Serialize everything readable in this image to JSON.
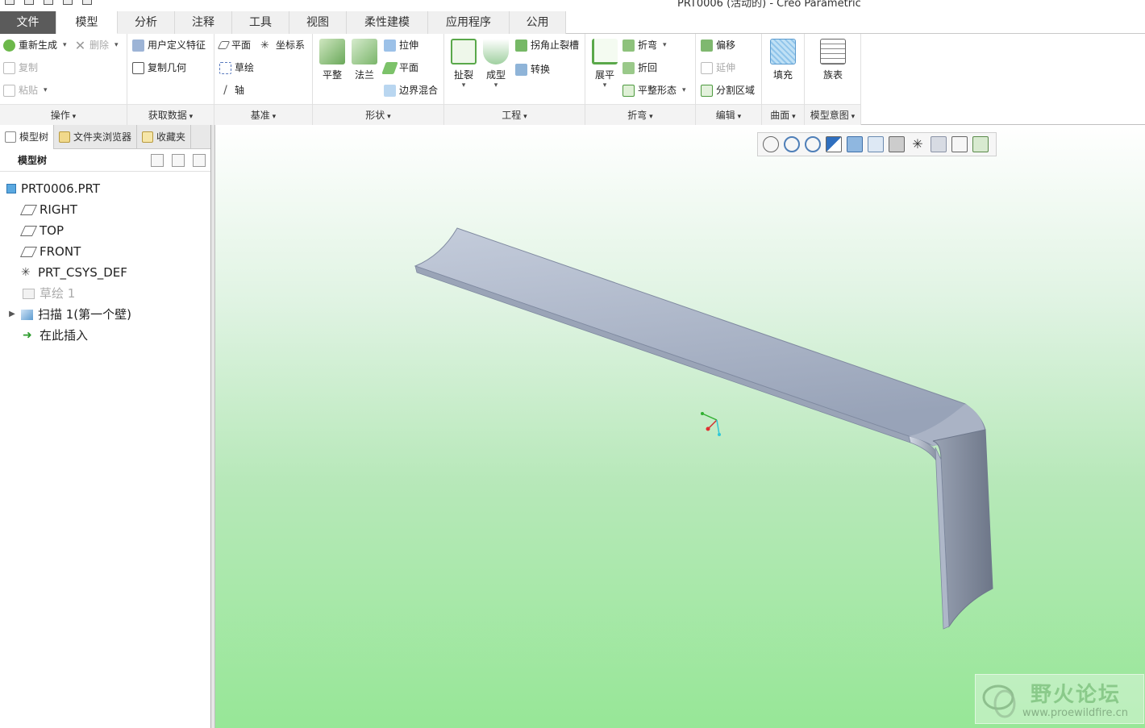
{
  "window": {
    "title": "PRT0006 (活动的) - Creo Parametric"
  },
  "tabs": [
    {
      "label": "文件"
    },
    {
      "label": "模型"
    },
    {
      "label": "分析"
    },
    {
      "label": "注释"
    },
    {
      "label": "工具"
    },
    {
      "label": "视图"
    },
    {
      "label": "柔性建模"
    },
    {
      "label": "应用程序"
    },
    {
      "label": "公用"
    }
  ],
  "ribbon": {
    "operations": {
      "footer": "操作",
      "regenerate": "重新生成",
      "delete": "删除",
      "copy": "复制",
      "paste": "粘贴"
    },
    "get_data": {
      "footer": "获取数据",
      "udf": "用户定义特征",
      "copy_geom": "复制几何"
    },
    "datum": {
      "footer": "基准",
      "plane": "平面",
      "csys": "坐标系",
      "sketch": "草绘",
      "axis": "轴"
    },
    "shape": {
      "footer": "形状",
      "flat": "平整",
      "flange": "法兰",
      "extrude": "拉伸",
      "planar": "平面",
      "blend": "边界混合"
    },
    "engineering": {
      "footer": "工程",
      "rip": "扯裂",
      "form": "成型",
      "corner_relief": "拐角止裂槽",
      "convert": "转换"
    },
    "bend": {
      "footer": "折弯",
      "unbend": "展平",
      "bend": "折弯",
      "bend_back": "折回",
      "flat_state": "平整形态"
    },
    "editing": {
      "footer": "编辑",
      "offset": "偏移",
      "extend": "延伸",
      "split_area": "分割区域"
    },
    "surface": {
      "footer": "曲面",
      "fill": "填充"
    },
    "intent": {
      "footer": "模型意图",
      "family": "族表"
    }
  },
  "panel": {
    "tabs": [
      {
        "label": "模型树"
      },
      {
        "label": "文件夹浏览器"
      },
      {
        "label": "收藏夹"
      }
    ],
    "header": "模型树",
    "tree": [
      {
        "label": "PRT0006.PRT"
      },
      {
        "label": "RIGHT"
      },
      {
        "label": "TOP"
      },
      {
        "label": "FRONT"
      },
      {
        "label": "PRT_CSYS_DEF"
      },
      {
        "label": "草绘 1"
      },
      {
        "label": "扫描 1(第一个壁)"
      },
      {
        "label": "在此插入"
      }
    ]
  },
  "watermark": {
    "title": "野火论坛",
    "url": "www.proewildfire.cn"
  },
  "colors": {
    "file_tab": "#5b5b5b",
    "model_face": "#a8b3c6",
    "model_edge": "#7f8aa0"
  }
}
